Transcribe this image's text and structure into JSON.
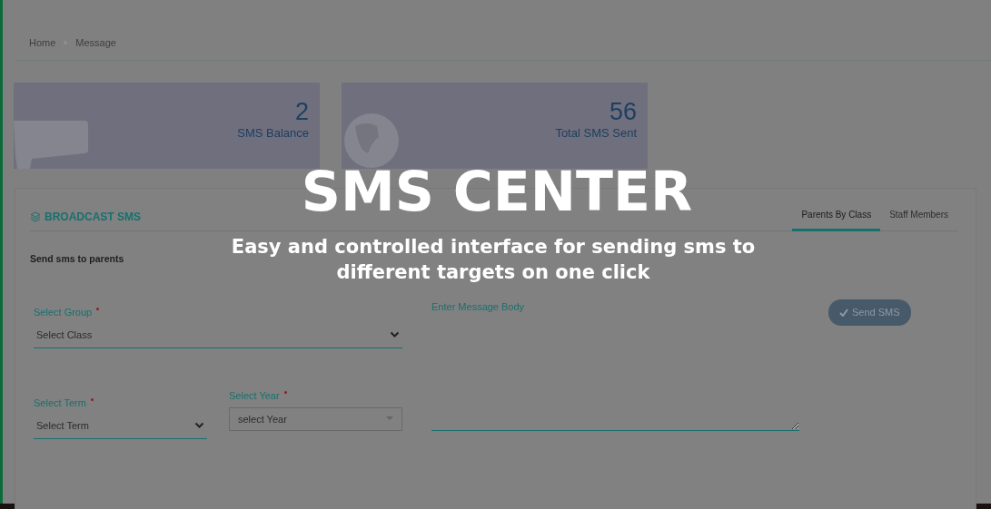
{
  "overlay": {
    "headline": "SMS CENTER",
    "tagline": "Easy and controlled interface for sending sms to different targets on one click"
  },
  "breadcrumb": [
    {
      "label": "Home"
    },
    {
      "label": "Message"
    }
  ],
  "stats": [
    {
      "value": "2",
      "label": "SMS Balance",
      "kind": "device"
    },
    {
      "value": "56",
      "label": "Total SMS Sent",
      "kind": "globe"
    }
  ],
  "panel": {
    "title": "BROADCAST SMS",
    "tabs": [
      {
        "label": "Parents By Class",
        "selected": true
      },
      {
        "label": "Staff Members",
        "selected": false
      }
    ],
    "intro": "Send sms to parents",
    "group": {
      "label": "Select Group",
      "required": true,
      "value": "Select Class"
    },
    "term": {
      "label": "Select Term",
      "required": true,
      "value": "Select Term"
    },
    "year": {
      "label": "Select Year",
      "required": true,
      "value": "select Year"
    },
    "message": {
      "label": "Enter Message Body"
    },
    "send_button": "Send SMS"
  }
}
